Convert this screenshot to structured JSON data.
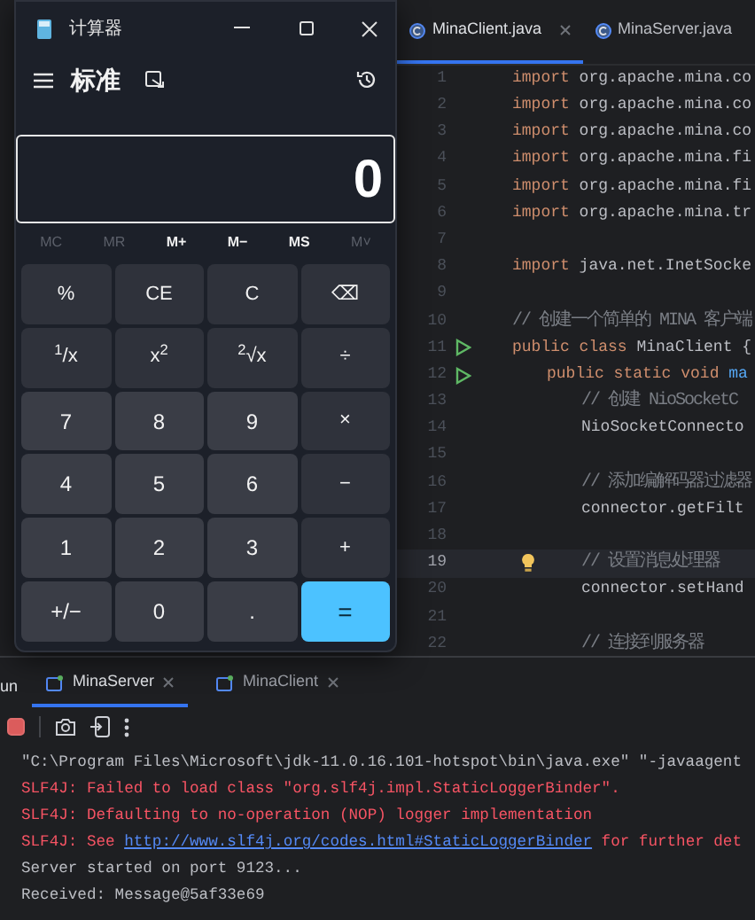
{
  "editor": {
    "tabs": [
      {
        "label": "MinaClient.java",
        "selected": true,
        "closable": true
      },
      {
        "label": "MinaServer.java",
        "selected": false,
        "closable": false
      }
    ],
    "lines": [
      {
        "number": "1",
        "current": false,
        "tokens": [
          {
            "text": "import",
            "kind": "keyword"
          },
          {
            "text": " org.apache.mina.co",
            "kind": "plain"
          }
        ]
      },
      {
        "number": "2",
        "current": false,
        "tokens": [
          {
            "text": "import",
            "kind": "keyword"
          },
          {
            "text": " org.apache.mina.co",
            "kind": "plain"
          }
        ]
      },
      {
        "number": "3",
        "current": false,
        "tokens": [
          {
            "text": "import",
            "kind": "keyword"
          },
          {
            "text": " org.apache.mina.co",
            "kind": "plain"
          }
        ]
      },
      {
        "number": "4",
        "current": false,
        "tokens": [
          {
            "text": "import",
            "kind": "keyword"
          },
          {
            "text": " org.apache.mina.fi",
            "kind": "plain"
          }
        ]
      },
      {
        "number": "5",
        "current": false,
        "tokens": [
          {
            "text": "import",
            "kind": "keyword"
          },
          {
            "text": " org.apache.mina.fi",
            "kind": "plain"
          }
        ]
      },
      {
        "number": "6",
        "current": false,
        "tokens": [
          {
            "text": "import",
            "kind": "keyword"
          },
          {
            "text": " org.apache.mina.tr",
            "kind": "plain"
          }
        ]
      },
      {
        "number": "7",
        "current": false
      },
      {
        "number": "8",
        "current": false,
        "tokens": [
          {
            "text": "import",
            "kind": "keyword"
          },
          {
            "text": " java.net.InetSocke",
            "kind": "plain"
          }
        ]
      },
      {
        "number": "9",
        "current": false
      },
      {
        "number": "10",
        "current": false,
        "tokens": [
          {
            "text": "// 创建一个简单的 MINA 客户端",
            "kind": "comment"
          }
        ]
      },
      {
        "number": "11",
        "current": false,
        "runnable": true,
        "tokens": [
          {
            "text": "public class",
            "kind": "keyword"
          },
          {
            "text": " MinaClient {",
            "kind": "plain"
          }
        ],
        "children": [
          {
            "number": "12",
            "current": false,
            "runnable": true,
            "tokens": [
              {
                "text": "public static void",
                "kind": "keyword"
              },
              {
                "text": " ma",
                "kind": "method"
              }
            ],
            "children": [
              {
                "number": "13",
                "current": false,
                "tokens": [
                  {
                    "text": "// 创建 NioSocketC",
                    "kind": "comment"
                  }
                ]
              },
              {
                "number": "14",
                "current": false,
                "tokens": [
                  {
                    "text": "NioSocketConnecto",
                    "kind": "plain"
                  }
                ]
              },
              {
                "number": "15",
                "current": false
              },
              {
                "number": "16",
                "current": false,
                "tokens": [
                  {
                    "text": "// 添加编解码器过滤器",
                    "kind": "comment"
                  }
                ]
              },
              {
                "number": "17",
                "current": false,
                "tokens": [
                  {
                    "text": "connector.getFilt",
                    "kind": "plain"
                  }
                ]
              },
              {
                "number": "18",
                "current": false
              },
              {
                "number": "19",
                "current": true,
                "hint": true,
                "tokens": [
                  {
                    "text": "// 设置消息处理器",
                    "kind": "comment"
                  }
                ]
              },
              {
                "number": "20",
                "current": false,
                "tokens": [
                  {
                    "text": "connector.setHand",
                    "kind": "plain"
                  }
                ]
              },
              {
                "number": "21",
                "current": false
              },
              {
                "number": "22",
                "current": false,
                "tokens": [
                  {
                    "text": "// 连接到服务器",
                    "kind": "comment"
                  }
                ]
              }
            ]
          }
        ]
      }
    ]
  },
  "run_panel": {
    "title": "un",
    "tabs": [
      {
        "label": "MinaServer",
        "selected": true
      },
      {
        "label": "MinaClient",
        "selected": false
      }
    ],
    "console": [
      [
        {
          "text": "\"C:\\Program Files\\Microsoft\\jdk-11.0.16.101-hotspot\\bin\\java.exe\" \"-javaagent",
          "kind": "normal"
        }
      ],
      [
        {
          "text": "SLF4J: Failed to load class \"org.slf4j.impl.StaticLoggerBinder\".",
          "kind": "error"
        }
      ],
      [
        {
          "text": "SLF4J: Defaulting to no-operation (NOP) logger implementation",
          "kind": "error"
        }
      ],
      [
        {
          "text": "SLF4J: See ",
          "kind": "error"
        },
        {
          "text": "http://www.slf4j.org/codes.html#StaticLoggerBinder",
          "kind": "link"
        },
        {
          "text": " for further det",
          "kind": "error"
        }
      ],
      [
        {
          "text": "Server started on port 9123...",
          "kind": "normal"
        }
      ],
      [
        {
          "text": "Received: Message@5af33e69",
          "kind": "normal"
        }
      ]
    ]
  },
  "calculator": {
    "title": "计算器",
    "mode": "标准",
    "display": "0",
    "memory_buttons": [
      {
        "label": "MC",
        "disabled": true
      },
      {
        "label": "MR",
        "disabled": true
      },
      {
        "label": "M+",
        "disabled": false
      },
      {
        "label": "M−",
        "disabled": false
      },
      {
        "label": "MS",
        "disabled": false
      },
      {
        "label": "M˅",
        "disabled": true
      }
    ],
    "keys": [
      {
        "label": "%",
        "kind": "function"
      },
      {
        "label": "CE",
        "kind": "function"
      },
      {
        "label": "C",
        "kind": "function"
      },
      {
        "label": "⌫",
        "kind": "function"
      },
      {
        "label": "$^{1}$/x",
        "kind": "function"
      },
      {
        "label": "x$^{2}$",
        "kind": "function"
      },
      {
        "label": "$^{2}$√x",
        "kind": "function"
      },
      {
        "label": "÷",
        "kind": "function"
      },
      {
        "label": "7",
        "kind": "digit"
      },
      {
        "label": "8",
        "kind": "digit"
      },
      {
        "label": "9",
        "kind": "digit"
      },
      {
        "label": "×",
        "kind": "function"
      },
      {
        "label": "4",
        "kind": "digit"
      },
      {
        "label": "5",
        "kind": "digit"
      },
      {
        "label": "6",
        "kind": "digit"
      },
      {
        "label": "−",
        "kind": "function"
      },
      {
        "label": "1",
        "kind": "digit"
      },
      {
        "label": "2",
        "kind": "digit"
      },
      {
        "label": "3",
        "kind": "digit"
      },
      {
        "label": "+",
        "kind": "function"
      },
      {
        "label": "+/−",
        "kind": "digit"
      },
      {
        "label": "0",
        "kind": "digit"
      },
      {
        "label": ".",
        "kind": "digit"
      },
      {
        "label": "=",
        "kind": "equals"
      }
    ]
  }
}
